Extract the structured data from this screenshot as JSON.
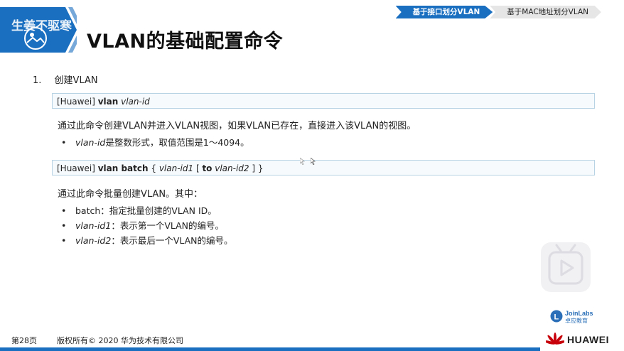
{
  "header": {
    "watermark": "生姜不驱寒",
    "title": "VLAN的基础配置命令",
    "accent_color": "#1a6fc1"
  },
  "nav": {
    "tabs": [
      {
        "label": "基于接口划分VLAN",
        "active": true
      },
      {
        "label": "基于MAC地址划分VLAN",
        "active": false
      }
    ]
  },
  "section": {
    "number": "1.",
    "heading": "创建VLAN"
  },
  "cmd1": {
    "prefix": "[Huawei] ",
    "keyword": "vlan",
    "param": "vlan-id"
  },
  "desc1": "通过此命令创建VLAN并进入VLAN视图，如果VLAN已存在，直接进入该VLAN的视图。",
  "bullets1": [
    {
      "term": "vlan-id",
      "text": "是整数形式，取值范围是1～4094。"
    }
  ],
  "cmd2": {
    "prefix": "[Huawei] ",
    "keyword": "vlan batch",
    "open": " { ",
    "param1": "vlan-id1",
    "bracket_open": " [ ",
    "to": "to",
    "param2": "vlan-id2",
    "close": " ] }"
  },
  "desc2": "通过此命令批量创建VLAN。其中：",
  "bullets2": [
    {
      "term": "batch",
      "text": "：指定批量创建的VLAN ID。"
    },
    {
      "term": "vlan-id1",
      "text": "：表示第一个VLAN的编号。"
    },
    {
      "term": "vlan-id2",
      "text": "：表示最后一个VLAN的编号。"
    }
  ],
  "footer": {
    "page": "第28页",
    "copyright": "版权所有© 2020 华为技术有限公司"
  },
  "logos": {
    "joinlabs_name": "JoinLabs",
    "joinlabs_cn": "卓应教育",
    "huawei": "HUAWEI"
  }
}
